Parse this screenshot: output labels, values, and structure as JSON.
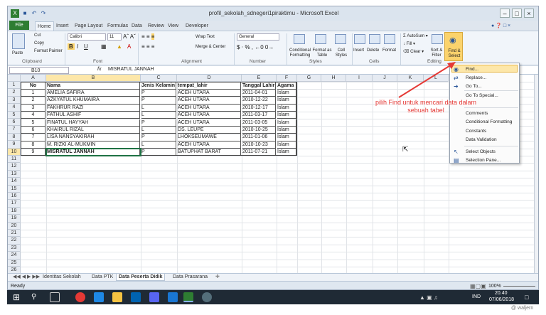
{
  "window": {
    "title": "profil_sekolah_sdnegeri1piraktimu  -  Microsoft Excel"
  },
  "ribbon_tabs": [
    "File",
    "Home",
    "Insert",
    "Page Layout",
    "Formulas",
    "Data",
    "Review",
    "View",
    "Developer"
  ],
  "ribbon": {
    "clipboard": {
      "paste": "Paste",
      "cut": "Cut",
      "copy": "Copy",
      "format_painter": "Format Painter",
      "label": "Clipboard"
    },
    "font": {
      "name": "Calibri",
      "size": "11",
      "label": "Font"
    },
    "alignment": {
      "wrap": "Wrap Text",
      "merge": "Merge & Center",
      "label": "Alignment"
    },
    "number": {
      "format": "General",
      "label": "Number"
    },
    "styles": {
      "cond": "Conditional Formatting",
      "table": "Format as Table",
      "cell": "Cell Styles",
      "label": "Styles"
    },
    "cells": {
      "insert": "Insert",
      "delete": "Delete",
      "format": "Format",
      "label": "Cells"
    },
    "editing": {
      "autosum": "AutoSum",
      "fill": "Fill",
      "clear": "Clear",
      "sort": "Sort & Filter",
      "find": "Find & Select",
      "label": "Editing"
    }
  },
  "formula_bar": {
    "name_box": "B10",
    "fx": "fx",
    "value": "MISRATUL JANNAH"
  },
  "columns": [
    "A",
    "B",
    "C",
    "D",
    "E",
    "F",
    "G",
    "H",
    "I",
    "J",
    "K",
    "L"
  ],
  "header_row": [
    "No",
    "Nama",
    "Jenis Kelamin",
    "tempat_lahir",
    "Tanggal Lahir",
    "Agama"
  ],
  "rows": [
    [
      "1",
      "AMELIA SAFIRA",
      "P",
      "ACEH UTARA",
      "2011-04-01",
      "Islam"
    ],
    [
      "2",
      "AZKYATUL KHUMAIRA",
      "P",
      "ACEH UTARA",
      "2010-12-22",
      "Islam"
    ],
    [
      "3",
      "FAKHRUR RAZI",
      "L",
      "ACEH UTARA",
      "2010-12-17",
      "Islam"
    ],
    [
      "4",
      "FATHUL ASHIF",
      "L",
      "ACEH UTARA",
      "2011-03-17",
      "Islam"
    ],
    [
      "5",
      "FINATUL HAYYAH",
      "P",
      "ACEH UTARA",
      "2011-03-05",
      "Islam"
    ],
    [
      "6",
      "KHAIRUL RIZAL",
      "L",
      "DS. LEUPE",
      "2010-10-25",
      "Islam"
    ],
    [
      "7",
      "LISA NANSYAKIRAH",
      "P",
      "LHOKSEUMAWE",
      "2011-01-06",
      "Islam"
    ],
    [
      "8",
      "M. RIZKI AL-MUKMIN",
      "L",
      "ACEH UTARA",
      "2010-10-23",
      "Islam"
    ],
    [
      "9",
      "MISRATUL JANNAH",
      "P",
      "BATUPHAT BARAT",
      "2011-07-21",
      "Islam"
    ]
  ],
  "row_numbers": [
    "1",
    "2",
    "3",
    "4",
    "5",
    "6",
    "7",
    "8",
    "9",
    "10",
    "11",
    "12",
    "13",
    "14",
    "15",
    "16",
    "17",
    "18",
    "19",
    "20",
    "21",
    "22",
    "23",
    "24",
    "25",
    "26"
  ],
  "find_menu": [
    {
      "label": "Find...",
      "icon": "binoculars-icon"
    },
    {
      "label": "Replace...",
      "icon": "replace-icon"
    },
    {
      "label": "Go To...",
      "icon": "arrow-right-icon"
    },
    {
      "label": "Go To Special...",
      "icon": ""
    },
    {
      "label": "Comments",
      "icon": ""
    },
    {
      "label": "Conditional Formatting",
      "icon": ""
    },
    {
      "label": "Constants",
      "icon": ""
    },
    {
      "label": "Data Validation",
      "icon": ""
    },
    {
      "label": "Select Objects",
      "icon": "pointer-icon"
    },
    {
      "label": "Selection Pane...",
      "icon": "selection-pane-icon"
    }
  ],
  "annotation": "pilih Find untuk mencari data dalam sebuah tabel",
  "sheet_tabs": [
    "Identitas Sekolah",
    "Data PTK",
    "Data Peserta Didik",
    "Data Prasarana"
  ],
  "active_sheet": "Data Peserta Didik",
  "status": {
    "ready": "Ready",
    "zoom": "100%"
  },
  "taskbar": {
    "lang": "IND",
    "time": "20.40",
    "date": "07/06/2018"
  },
  "watermark": "@ waljern",
  "colors": {
    "excel_green": "#2e7d32",
    "find_highlight": "#fbd36c",
    "selected_cell_border": "#1f7244",
    "annotation": "#e53935"
  }
}
